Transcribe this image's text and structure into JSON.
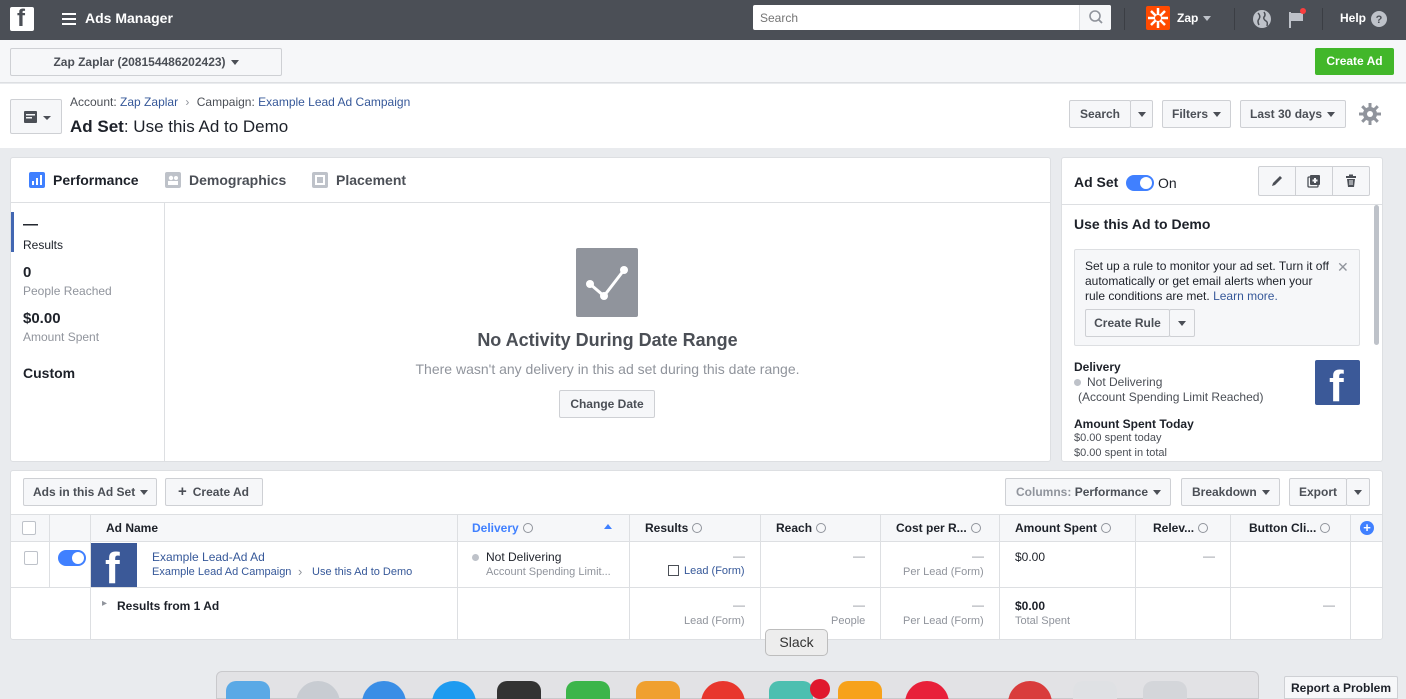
{
  "topbar": {
    "logo": "f",
    "title": "Ads Manager",
    "search_placeholder": "Search",
    "account_short": "Zap",
    "help": "Help",
    "icons": [
      "menu-icon",
      "search-icon",
      "globe-icon",
      "flag-icon",
      "help-icon"
    ]
  },
  "account": {
    "selector": "Zap Zaplar (208154486202423)",
    "create_ad": "Create Ad"
  },
  "header": {
    "breadcrumb_account_label": "Account:",
    "breadcrumb_account": "Zap Zaplar",
    "breadcrumb_campaign_label": "Campaign:",
    "breadcrumb_campaign": "Example Lead Ad Campaign",
    "title_label": "Ad Set",
    "title_value": ": Use this Ad to Demo",
    "search_btn": "Search",
    "filters_btn": "Filters",
    "date_btn": "Last 30 days"
  },
  "performance": {
    "tabs": [
      "Performance",
      "Demographics",
      "Placement"
    ],
    "metrics": [
      {
        "value": "—",
        "label": "Results"
      },
      {
        "value": "0",
        "label": "People Reached"
      },
      {
        "value": "$0.00",
        "label": "Amount Spent"
      },
      {
        "value": "Custom",
        "label": ""
      }
    ],
    "empty_title": "No Activity During Date Range",
    "empty_text": "There wasn't any delivery in this ad set during this date range.",
    "change_date": "Change Date"
  },
  "adset_panel": {
    "label": "Ad Set",
    "status": "On",
    "name": "Use this Ad to Demo",
    "rule_text": "Set up a rule to monitor your ad set. Turn it off automatically or get email alerts when your rule conditions are met.",
    "rule_link": "Learn more.",
    "create_rule": "Create Rule",
    "delivery_label": "Delivery",
    "delivery_value": "Not Delivering",
    "delivery_reason": "(Account Spending Limit Reached)",
    "spent_label": "Amount Spent Today",
    "spent_today": "$0.00 spent today",
    "spent_total": "$0.00 spent in total"
  },
  "ads_table": {
    "scope_btn": "Ads in this Ad Set",
    "create_ad": "Create Ad",
    "columns_label": "Columns:",
    "columns_value": "Performance",
    "breakdown": "Breakdown",
    "export": "Export",
    "headers": {
      "ad_name": "Ad Name",
      "delivery": "Delivery",
      "results": "Results",
      "reach": "Reach",
      "cost": "Cost per R...",
      "spent": "Amount Spent",
      "relevance": "Relev...",
      "button_clicks": "Button Cli..."
    },
    "row": {
      "ad_name": "Example Lead-Ad Ad",
      "campaign": "Example Lead Ad Campaign",
      "adset": "Use this Ad to Demo",
      "delivery": "Not Delivering",
      "delivery_sub": "Account Spending Limit...",
      "results": "—",
      "results_sub": "Lead (Form)",
      "reach": "—",
      "cost": "—",
      "cost_sub": "Per Lead (Form)",
      "spent": "$0.00",
      "relevance": "—"
    },
    "summary": {
      "label": "Results from 1 Ad",
      "results": "—",
      "results_sub": "Lead (Form)",
      "reach": "—",
      "reach_sub": "People",
      "cost": "—",
      "cost_sub": "Per Lead (Form)",
      "spent": "$0.00",
      "spent_sub": "Total Spent",
      "button_clicks": "—"
    }
  },
  "dock": {
    "tooltip": "Slack"
  },
  "report_problem": "Report a Problem",
  "colors": {
    "topbar": "#4b4f56",
    "create_button": "#42b72a",
    "toggle_on": "#4080ff",
    "link": "#365899",
    "facebook_blue": "#3b5998"
  }
}
